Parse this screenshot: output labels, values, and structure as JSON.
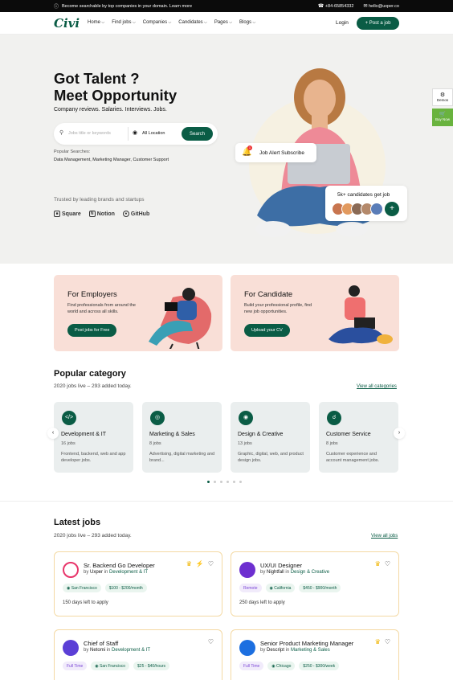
{
  "topbar": {
    "announce": "Become searchable by top companies in your domain. Learn more",
    "phone": "+84-65854332",
    "email": "hello@uxper.co"
  },
  "nav": {
    "logo": "Civi",
    "menu": [
      "Home",
      "Find jobs",
      "Companies",
      "Candidates",
      "Pages",
      "Blogs"
    ],
    "login": "Login",
    "post_job": "+ Post a job"
  },
  "hero": {
    "title_line1": "Got Talent ?",
    "title_line2": "Meet Opportunity",
    "subtitle": "Company reviews. Salaries. Interviews. Jobs.",
    "search_placeholder": "Jobs title or keywords",
    "location": "All Location",
    "search_button": "Search",
    "popular_label": "Popular Searches:",
    "popular_values": "Data Management, Marketing Manager, Customer Support",
    "trusted": "Trusted by leading brands and startups",
    "brands": [
      "Square",
      "Notion",
      "GitHub"
    ],
    "alert_text": "Job Alert Subscribe",
    "alert_count": "1",
    "candidates_text": "5k+ candidates get job",
    "avatar_colors": [
      "#c8754f",
      "#e29a5f",
      "#8a6a55",
      "#b4896b",
      "#5a7db8"
    ],
    "side_demos": "Demos",
    "side_buy": "Buy Now"
  },
  "employers": {
    "title": "For Employers",
    "desc": "Find professionals from around the world and across all skills.",
    "button": "Post jobs for Free"
  },
  "candidate": {
    "title": "For Candidate",
    "desc": "Build your professional profile, find new job opportunities.",
    "button": "Upload your CV"
  },
  "popular": {
    "title": "Popular category",
    "subtitle": "2020 jobs live – 293 added today.",
    "view_all": "View all categories",
    "items": [
      {
        "name": "Development & IT",
        "count": "16 jobs",
        "desc": "Frontend, backend, web and app developer jobs.",
        "icon": "code-icon"
      },
      {
        "name": "Marketing & Sales",
        "count": "8 jobs",
        "desc": "Advertising, digital marketing and brand...",
        "icon": "target-icon"
      },
      {
        "name": "Design & Creative",
        "count": "13 jobs",
        "desc": "Graphic, digital, web, and product design jobs.",
        "icon": "palette-icon"
      },
      {
        "name": "Customer Service",
        "count": "8 jobs",
        "desc": "Customer experience and account management jobs.",
        "icon": "headset-icon"
      }
    ]
  },
  "latest": {
    "title": "Latest jobs",
    "subtitle": "2020 jobs live – 293 added today.",
    "view_all": "View all jobs",
    "jobs": [
      {
        "title": "Sr. Backend Go Developer",
        "by": "by",
        "company": "Uxper",
        "in": "in",
        "category": "Development & IT",
        "tags": [
          "San Francisco",
          "$100 - $200/month"
        ],
        "days": "150 days left to apply",
        "logo_color": "#e8366b"
      },
      {
        "title": "UX/UI Designer",
        "by": "by",
        "company": "Nightfall",
        "in": "in",
        "category": "Design & Creative",
        "tags": [
          "Remote",
          "California",
          "$450 - $900/month"
        ],
        "days": "250 days left to apply",
        "logo_color": "#6d2fd0"
      },
      {
        "title": "Chief of Staff",
        "by": "by",
        "company": "Netomi",
        "in": "in",
        "category": "Development & IT",
        "tags": [
          "Full Time",
          "San Francisco",
          "$25 - $40/hours"
        ],
        "logo_color": "#5b3fd6"
      },
      {
        "title": "Senior Product Marketing Manager",
        "by": "by",
        "company": "Descript",
        "in": "in",
        "category": "Marketing & Sales",
        "tags": [
          "Full Time",
          "Chicago",
          "$250 - $300/week"
        ],
        "logo_color": "#1c6fe0"
      }
    ]
  }
}
